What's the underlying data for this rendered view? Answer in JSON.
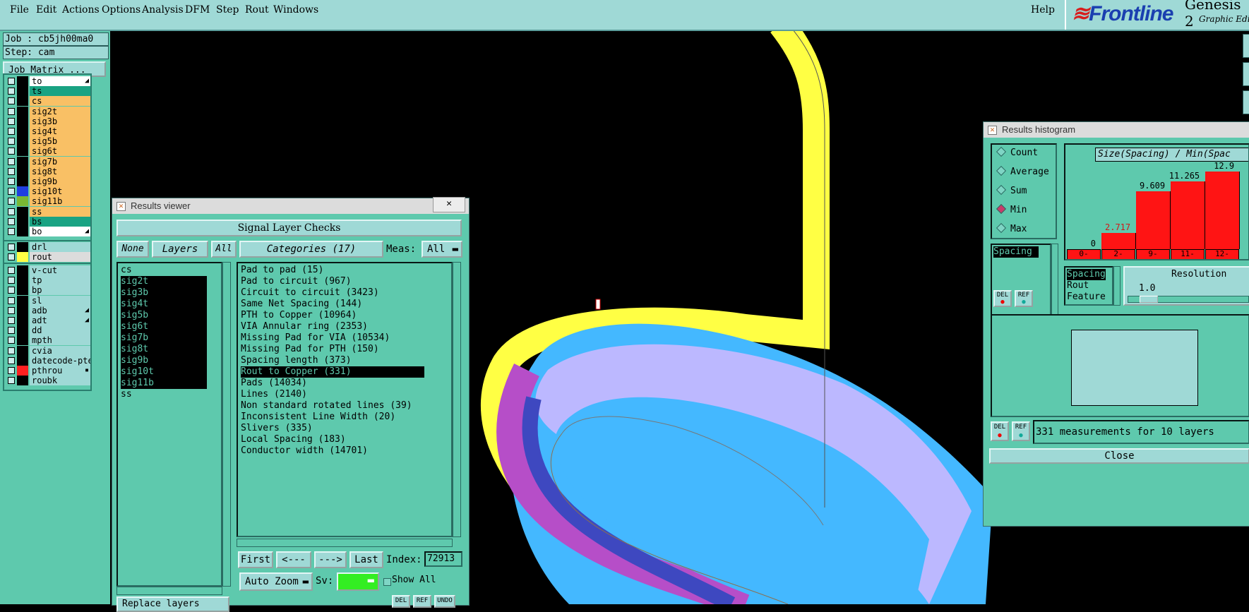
{
  "menu": {
    "items": [
      "File",
      "Edit",
      "Actions",
      "Options",
      "Analysis",
      "DFM",
      "Step",
      "Rout",
      "Windows"
    ],
    "help": "Help"
  },
  "brand": {
    "logo": "Frontline",
    "product": "Genesis 2",
    "subtitle": "Graphic Edi"
  },
  "job": {
    "job_label": "Job : cb5jh00ma0",
    "step_label": "Step: cam",
    "matrix_button": "Job Matrix ..."
  },
  "layers": {
    "group1": [
      {
        "name": "to",
        "color": "#ffffff",
        "swatch": "#000000",
        "mark": "◢"
      },
      {
        "name": "ts",
        "color": "#1aa383",
        "swatch": "#000000"
      },
      {
        "name": "cs",
        "color": "#f9c065",
        "swatch": "#000000"
      },
      {
        "name": "sig2t",
        "color": "#f9c065",
        "swatch": "#000000"
      },
      {
        "name": "sig3b",
        "color": "#f9c065",
        "swatch": "#000000"
      },
      {
        "name": "sig4t",
        "color": "#f9c065",
        "swatch": "#000000"
      },
      {
        "name": "sig5b",
        "color": "#f9c065",
        "swatch": "#000000"
      },
      {
        "name": "sig6t",
        "color": "#f9c065",
        "swatch": "#000000"
      },
      {
        "name": "sig7b",
        "color": "#f9c065",
        "swatch": "#000000"
      },
      {
        "name": "sig8t",
        "color": "#f9c065",
        "swatch": "#000000"
      },
      {
        "name": "sig9b",
        "color": "#f9c065",
        "swatch": "#000000"
      },
      {
        "name": "sig10t",
        "color": "#f9c065",
        "swatch": "#1f3fe0"
      },
      {
        "name": "sig11b",
        "color": "#f9c065",
        "swatch": "#7ab833"
      },
      {
        "name": "ss",
        "color": "#f9c065",
        "swatch": "#000000"
      },
      {
        "name": "bs",
        "color": "#1aa383",
        "swatch": "#000000"
      },
      {
        "name": "bo",
        "color": "#ffffff",
        "swatch": "#000000",
        "mark": "◢"
      }
    ],
    "group2": [
      {
        "name": "drl",
        "color": "#9fd9d6",
        "swatch": "#000000"
      },
      {
        "name": "rout",
        "color": "#dcdcdc",
        "swatch": "#ffff44"
      }
    ],
    "group3": [
      {
        "name": "v-cut",
        "color": "#9fd9d6",
        "swatch": "#000000"
      },
      {
        "name": "tp",
        "color": "#9fd9d6",
        "swatch": "#000000"
      },
      {
        "name": "bp",
        "color": "#9fd9d6",
        "swatch": "#000000"
      },
      {
        "name": "sl",
        "color": "#9fd9d6",
        "swatch": "#000000"
      },
      {
        "name": "adb",
        "color": "#9fd9d6",
        "swatch": "#000000",
        "mark": "◢"
      },
      {
        "name": "adt",
        "color": "#9fd9d6",
        "swatch": "#000000",
        "mark": "◢"
      },
      {
        "name": "dd",
        "color": "#9fd9d6",
        "swatch": "#000000"
      },
      {
        "name": "mpth",
        "color": "#9fd9d6",
        "swatch": "#000000"
      },
      {
        "name": "cvia",
        "color": "#9fd9d6",
        "swatch": "#000000"
      },
      {
        "name": "datecode-pte",
        "color": "#9fd9d6",
        "swatch": "#000000"
      },
      {
        "name": "pthrou",
        "color": "#9fd9d6",
        "swatch": "#ff2020",
        "mark": "▪"
      },
      {
        "name": "roubk",
        "color": "#9fd9d6",
        "swatch": "#000000"
      }
    ]
  },
  "results_viewer": {
    "title": "Results viewer",
    "close_glyph": "✕",
    "header": "Signal Layer Checks",
    "none_button": "None",
    "layers_button": "Layers",
    "all_button": "All",
    "categories_button": "Categories (17)",
    "meas_label": "Meas:",
    "meas_value": "All",
    "layer_list": [
      {
        "name": "cs",
        "selected": false
      },
      {
        "name": "sig2t",
        "selected": true
      },
      {
        "name": "sig3b",
        "selected": true
      },
      {
        "name": "sig4t",
        "selected": true
      },
      {
        "name": "sig5b",
        "selected": true
      },
      {
        "name": "sig6t",
        "selected": true
      },
      {
        "name": "sig7b",
        "selected": true
      },
      {
        "name": "sig8t",
        "selected": true
      },
      {
        "name": "sig9b",
        "selected": true
      },
      {
        "name": "sig10t",
        "selected": true
      },
      {
        "name": "sig11b",
        "selected": true
      },
      {
        "name": "ss",
        "selected": false
      }
    ],
    "categories": [
      {
        "label": "Pad to pad (15)",
        "selected": false
      },
      {
        "label": "Pad to circuit (967)",
        "selected": false
      },
      {
        "label": "Circuit to circuit (3423)",
        "selected": false
      },
      {
        "label": "Same Net Spacing (144)",
        "selected": false
      },
      {
        "label": "PTH to Copper (10964)",
        "selected": false
      },
      {
        "label": "VIA Annular ring (2353)",
        "selected": false
      },
      {
        "label": "Missing Pad for VIA (10534)",
        "selected": false
      },
      {
        "label": "Missing Pad for PTH (150)",
        "selected": false
      },
      {
        "label": "Spacing length (373)",
        "selected": false
      },
      {
        "label": "Rout to Copper (331)",
        "selected": true
      },
      {
        "label": "Pads (14034)",
        "selected": false
      },
      {
        "label": "Lines (2140)",
        "selected": false
      },
      {
        "label": "Non standard rotated lines (39)",
        "selected": false
      },
      {
        "label": "Inconsistent Line Width (20)",
        "selected": false
      },
      {
        "label": "Slivers (335)",
        "selected": false
      },
      {
        "label": "Local Spacing (183)",
        "selected": false
      },
      {
        "label": "Conductor width (14701)",
        "selected": false
      }
    ],
    "nav": {
      "first": "First",
      "prev": "<---",
      "next": "--->",
      "last": "Last",
      "index_label": "Index:",
      "index_value": "72913"
    },
    "auto_zoom": "Auto Zoom",
    "sv_label": "Sv:",
    "show_all": "Show All",
    "replace_layers": "Replace layers",
    "small_buttons": [
      "DEL",
      "REF",
      "UNDO"
    ]
  },
  "histogram": {
    "title": "Results histogram",
    "modes": [
      {
        "label": "Count",
        "selected": false
      },
      {
        "label": "Average",
        "selected": false
      },
      {
        "label": "Sum",
        "selected": false
      },
      {
        "label": "Min",
        "selected": true
      },
      {
        "label": "Max",
        "selected": false
      }
    ],
    "chart_title": "Size(Spacing) / Min(Spac",
    "bins": [
      {
        "label_top": "0-",
        "label_bottom": "1",
        "value": 0,
        "value_text": "0"
      },
      {
        "label_top": "2-",
        "label_bottom": "3",
        "value": 2.717,
        "value_text": "2.717"
      },
      {
        "label_top": "9-",
        "label_bottom": "10",
        "value": 9.609,
        "value_text": "9.609"
      },
      {
        "label_top": "11-",
        "label_bottom": "12",
        "value": 11.265,
        "value_text": "11.265"
      },
      {
        "label_top": "12-",
        "label_bottom": "13",
        "value": 12.9,
        "value_text": "12.9"
      }
    ],
    "attr_list_top": [
      "Spacing"
    ],
    "attr_list_bottom": [
      {
        "label": "Spacing",
        "selected": true
      },
      {
        "label": "Rout",
        "selected": false
      },
      {
        "label": "Feature",
        "selected": false
      }
    ],
    "resolution_label": "Resolution",
    "resolution_value": "1.0",
    "del": "DEL",
    "ref": "REF",
    "status": "331 measurements for 10 layers",
    "close": "Close"
  },
  "chart_data": {
    "type": "bar",
    "title": "Size(Spacing) / Min(Spac",
    "categories": [
      "0-1",
      "2-3",
      "9-10",
      "11-12",
      "12-13"
    ],
    "values": [
      0,
      2.717,
      9.609,
      11.265,
      12.9
    ],
    "colors": {
      "bar": "#ff1414",
      "highlight_label": "#d01818"
    }
  },
  "colors": {
    "panel": "#5ec9ad",
    "menubar": "#9fd9d6",
    "trace_yellow": "#ffff44",
    "trace_blue": "#44b8ff",
    "trace_lavender": "#bcb8ff",
    "trace_magenta": "#b64ec8",
    "trace_darkblue": "#3e48c0"
  }
}
